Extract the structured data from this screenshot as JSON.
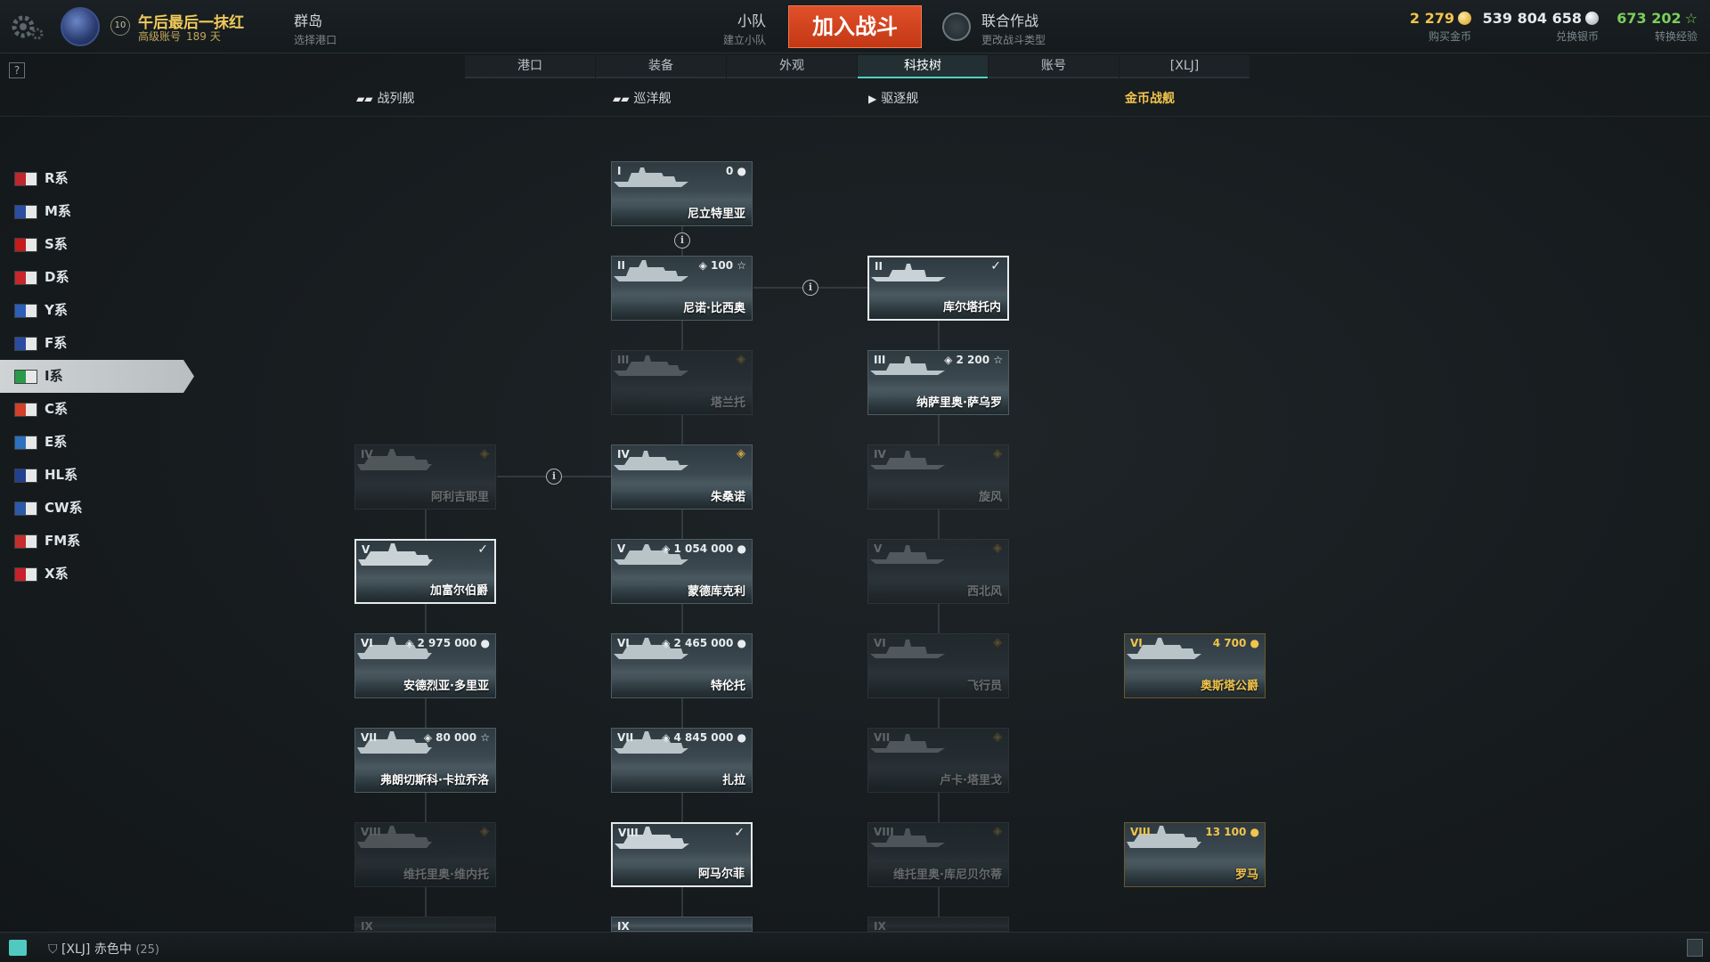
{
  "topbar": {
    "player_name": "午后最后一抹红",
    "account_type": "高级账号",
    "account_days": "189 天",
    "level": "10",
    "port_name": "群岛",
    "port_sub": "选择港口",
    "division_label": "小队",
    "division_sub": "建立小队",
    "battle_button": "加入战斗",
    "mode_label": "联合作战",
    "mode_sub": "更改战斗类型",
    "gold_amount": "2 279",
    "gold_label": "购买金币",
    "silver_amount": "539 804 658",
    "silver_label": "兑换银币",
    "xp_amount": "673 202",
    "xp_label": "转换经验"
  },
  "tabs": [
    "港口",
    "装备",
    "外观",
    "科技树",
    "账号",
    "[XLJ]"
  ],
  "active_tab": "科技树",
  "help_label": "?",
  "ship_types": {
    "battleship": "战列舰",
    "cruiser": "巡洋舰",
    "destroyer": "驱逐舰",
    "premium": "金币战舰"
  },
  "nations": [
    {
      "label": "R系",
      "color": "#c0262d"
    },
    {
      "label": "M系",
      "color": "#2b4ea0"
    },
    {
      "label": "S系",
      "color": "#c41b1b"
    },
    {
      "label": "D系",
      "color": "#c9262b"
    },
    {
      "label": "Y系",
      "color": "#2d5fb8"
    },
    {
      "label": "F系",
      "color": "#2a4ba0"
    },
    {
      "label": "I系",
      "color": "#2a9a48"
    },
    {
      "label": "C系",
      "color": "#d0402a"
    },
    {
      "label": "E系",
      "color": "#2f6fbf"
    },
    {
      "label": "HL系",
      "color": "#233f8f"
    },
    {
      "label": "CW系",
      "color": "#2c5aa8"
    },
    {
      "label": "FM系",
      "color": "#c62d2d"
    },
    {
      "label": "X系",
      "color": "#c8202a"
    }
  ],
  "active_nation": "I系",
  "ships": {
    "c1": {
      "tier": "I",
      "cost": "0",
      "name": "尼立特里亚"
    },
    "c2": {
      "tier": "II",
      "cost": "100",
      "name": "尼诺·比西奥"
    },
    "c3": {
      "tier": "III",
      "cost": "",
      "name": "塔兰托"
    },
    "c4": {
      "tier": "IV",
      "cost": "",
      "name": "朱桑诺"
    },
    "c5": {
      "tier": "V",
      "cost": "1 054 000",
      "name": "蒙德库克利"
    },
    "c6": {
      "tier": "VI",
      "cost": "2 465 000",
      "name": "特伦托"
    },
    "c7": {
      "tier": "VII",
      "cost": "4 845 000",
      "name": "扎拉"
    },
    "c8": {
      "tier": "VIII",
      "cost": "",
      "name": "阿马尔菲"
    },
    "c9": {
      "tier": "IX",
      "cost": "",
      "name": ""
    },
    "d2": {
      "tier": "II",
      "cost": "",
      "name": "库尔塔托内"
    },
    "d3": {
      "tier": "III",
      "cost": "2 200",
      "name": "纳萨里奥·萨乌罗"
    },
    "d4": {
      "tier": "IV",
      "cost": "",
      "name": "旋风"
    },
    "d5": {
      "tier": "V",
      "cost": "",
      "name": "西北风"
    },
    "d6": {
      "tier": "VI",
      "cost": "",
      "name": "飞行员"
    },
    "d7": {
      "tier": "VII",
      "cost": "",
      "name": "卢卡·塔里戈"
    },
    "d8": {
      "tier": "VIII",
      "cost": "",
      "name": "维托里奥·库尼贝尔蒂"
    },
    "d9": {
      "tier": "IX",
      "cost": "",
      "name": ""
    },
    "b4": {
      "tier": "IV",
      "cost": "",
      "name": "阿利吉耶里"
    },
    "b5": {
      "tier": "V",
      "cost": "",
      "name": "加富尔伯爵"
    },
    "b6": {
      "tier": "VI",
      "cost": "2 975 000",
      "name": "安德烈亚·多里亚"
    },
    "b7": {
      "tier": "VII",
      "cost": "80 000",
      "name": "弗朗切斯科·卡拉乔洛"
    },
    "b8": {
      "tier": "VIII",
      "cost": "",
      "name": "维托里奥·维内托"
    },
    "b9": {
      "tier": "IX",
      "cost": "",
      "name": ""
    },
    "p6": {
      "tier": "VI",
      "cost": "4 700",
      "name": "奥斯塔公爵"
    },
    "p8": {
      "tier": "VIII",
      "cost": "13 100",
      "name": "罗马"
    }
  },
  "info_label": "i",
  "bottombar": {
    "clan_tag": "[XLJ]",
    "status": "赤色中",
    "count": "(25)"
  },
  "colors": {
    "accent_teal": "#52d0c0",
    "gold": "#f2c44c",
    "battle_button": "#d8461f",
    "xp_green": "#7bd05a"
  }
}
